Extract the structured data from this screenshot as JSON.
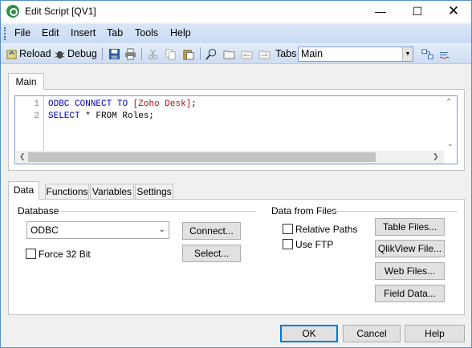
{
  "window": {
    "title": "Edit Script [QV1]"
  },
  "menu": [
    "File",
    "Edit",
    "Insert",
    "Tab",
    "Tools",
    "Help"
  ],
  "toolbar": {
    "reload_label": "Reload",
    "debug_label": "Debug",
    "tabs_label": "Tabs",
    "tabs_selected": "Main"
  },
  "script": {
    "tab_label": "Main",
    "lines": [
      {
        "num": "1",
        "kw1": "ODBC",
        "kw2": "CONNECT",
        "kw3": "TO",
        "str": "[Zoho Desk]",
        "tail": ";"
      },
      {
        "num": "2",
        "kw1": "SELECT",
        "rest": " * FROM Roles;"
      }
    ]
  },
  "bottom_tabs": [
    "Data",
    "Functions",
    "Variables",
    "Settings"
  ],
  "database": {
    "group_label": "Database",
    "selected": "ODBC",
    "connect_label": "Connect...",
    "select_label": "Select...",
    "force32_label": "Force 32 Bit"
  },
  "files": {
    "group_label": "Data from Files",
    "relative_paths_label": "Relative Paths",
    "use_ftp_label": "Use FTP",
    "table_files_label": "Table Files...",
    "qlikview_file_label": "QlikView File...",
    "web_files_label": "Web Files...",
    "field_data_label": "Field Data..."
  },
  "dialog": {
    "ok_label": "OK",
    "cancel_label": "Cancel",
    "help_label": "Help"
  }
}
